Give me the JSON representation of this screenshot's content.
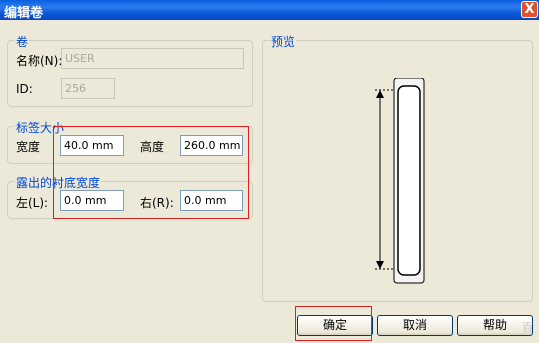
{
  "window": {
    "title": "编辑卷",
    "close_glyph": "X"
  },
  "volume": {
    "group_title": "卷",
    "name_label": "名称(N):",
    "name_value": "USER",
    "id_label": "ID:",
    "id_value": "256"
  },
  "label_size": {
    "group_title": "标签大小",
    "width_label": "宽度",
    "width_value": "40.0 mm",
    "height_label": "高度",
    "height_value": "260.0 mm"
  },
  "liner": {
    "group_title": "露出的衬底宽度",
    "left_label": "左(L):",
    "left_value": "0.0 mm",
    "right_label": "右(R):",
    "right_value": "0.0 mm"
  },
  "preview": {
    "group_title": "预览"
  },
  "buttons": {
    "ok": "确定",
    "cancel": "取消",
    "help": "帮助"
  },
  "colors": {
    "title_bar": "#0a5fe0",
    "legend_text": "#0046d5",
    "highlight_box": "#e02020"
  },
  "watermark": "百"
}
